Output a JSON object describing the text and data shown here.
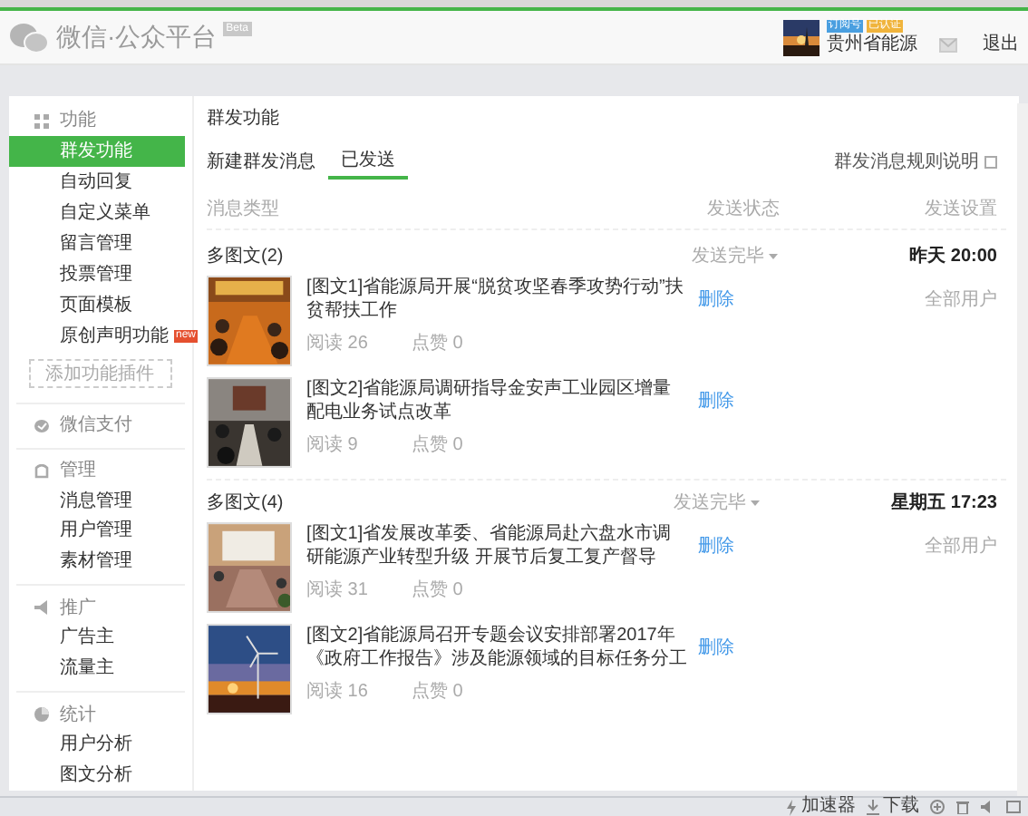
{
  "header": {
    "logo_text": "微信·公众平台",
    "badge": "Beta",
    "account": {
      "name": "贵州省能源",
      "tags": [
        {
          "label": "订阅号",
          "color": "#4a9fe0"
        },
        {
          "label": "已认证",
          "color": "#f0b43c"
        }
      ]
    },
    "logout": "退出"
  },
  "sidebar": {
    "sections": [
      {
        "label": "功能",
        "kind": "grid",
        "items": [
          {
            "label": "群发功能",
            "selected": true
          },
          {
            "label": "自动回复",
            "selected": false
          },
          {
            "label": "自定义菜单",
            "selected": false
          },
          {
            "label": "留言管理",
            "selected": false
          },
          {
            "label": "投票管理",
            "selected": false
          },
          {
            "label": "页面模板",
            "selected": false
          },
          {
            "label": "原创声明功能",
            "selected": false,
            "badge": "new"
          }
        ],
        "add_button": "添加功能插件"
      },
      {
        "label": "微信支付",
        "kind": "pay"
      },
      {
        "label": "管理",
        "kind": "manage",
        "items": [
          {
            "label": "消息管理",
            "selected": false
          },
          {
            "label": "用户管理",
            "selected": false
          },
          {
            "label": "素材管理",
            "selected": false
          }
        ]
      },
      {
        "label": "推广",
        "kind": "promo",
        "items": [
          {
            "label": "广告主",
            "selected": false
          },
          {
            "label": "流量主",
            "selected": false
          }
        ]
      },
      {
        "label": "统计",
        "kind": "stats",
        "items": [
          {
            "label": "用户分析",
            "selected": false
          },
          {
            "label": "图文分析",
            "selected": false
          }
        ]
      }
    ]
  },
  "content": {
    "title": "群发功能",
    "tabs": [
      {
        "label": "新建群发消息",
        "selected": false
      },
      {
        "label": "已发送",
        "selected": true
      }
    ],
    "rules_link": "群发消息规则说明",
    "columns": [
      "消息类型",
      "发送状态",
      "发送设置"
    ],
    "groups": [
      {
        "type": "多图文(2)",
        "status": "发送完毕",
        "time": "昨天 20:00",
        "audience": "全部用户",
        "articles": [
          {
            "title": "[图文1]省能源局开展“脱贫攻坚春季攻势行动”扶贫帮扶工作",
            "reads": "阅读 26",
            "likes": "点赞 0",
            "action": "删除"
          },
          {
            "title": "[图文2]省能源局调研指导金安声工业园区增量配电业务试点改革",
            "reads": "阅读 9",
            "likes": "点赞 0",
            "action": "删除"
          }
        ]
      },
      {
        "type": "多图文(4)",
        "status": "发送完毕",
        "time": "星期五 17:23",
        "audience": "全部用户",
        "articles": [
          {
            "title": "[图文1]省发展改革委、省能源局赴六盘水市调研能源产业转型升级 开展节后复工复产督导",
            "reads": "阅读 31",
            "likes": "点赞 0",
            "action": "删除"
          },
          {
            "title": "[图文2]省能源局召开专题会议安排部署2017年《政府工作报告》涉及能源领域的目标任务分工",
            "reads": "阅读 16",
            "likes": "点赞 0",
            "action": "删除"
          }
        ]
      }
    ]
  },
  "status_bar": {
    "items": [
      {
        "label": "加速器",
        "kind": "boost"
      },
      {
        "label": "下载",
        "kind": "download"
      }
    ]
  }
}
